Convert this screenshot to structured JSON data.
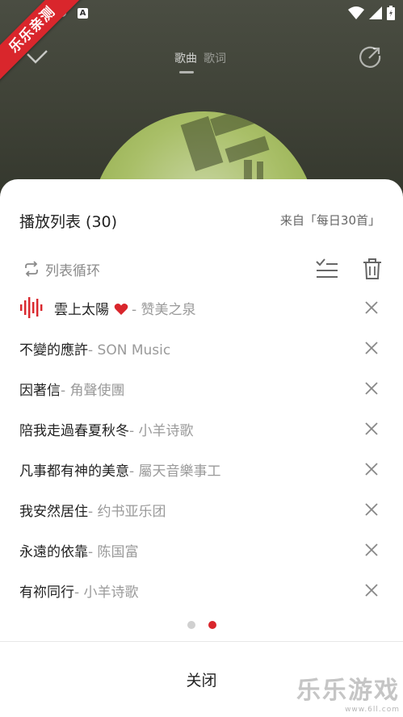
{
  "status_bar": {
    "icon_a": "A"
  },
  "ribbon": {
    "text": "乐乐亲测"
  },
  "player": {
    "tabs": [
      {
        "label": "歌曲",
        "active": true
      },
      {
        "label": "歌词",
        "active": false
      }
    ]
  },
  "playlist": {
    "title": "播放列表 (30)",
    "source": "来自「每日30首」",
    "mode_label": "列表循环",
    "songs": [
      {
        "title": "雲上太陽",
        "artist": "- 赞美之泉",
        "playing": true,
        "liked": true
      },
      {
        "title": "不變的應許",
        "artist": "- SON Music"
      },
      {
        "title": "因著信",
        "artist": "- 角聲使團"
      },
      {
        "title": "陪我走過春夏秋冬",
        "artist": "- 小羊诗歌"
      },
      {
        "title": "凡事都有神的美意",
        "artist": "- 屬天音樂事工"
      },
      {
        "title": "我安然居住",
        "artist": "- 约书亚乐团"
      },
      {
        "title": "永遠的依靠",
        "artist": "- 陈国富"
      },
      {
        "title": "有祢同行",
        "artist": "- 小羊诗歌"
      }
    ],
    "pager": {
      "total": 2,
      "active_index": 1
    },
    "close_label": "关闭"
  },
  "watermark": {
    "main": "乐乐游戏",
    "sub": "www.6ll.com"
  },
  "colors": {
    "accent": "#d9262c",
    "text_primary": "#222222",
    "text_secondary": "#9a9a9a"
  },
  "icons": [
    "collapse-check-icon",
    "share-icon",
    "repeat-icon",
    "multi-select-icon",
    "trash-icon",
    "equalizer-icon",
    "heart-icon",
    "close-icon"
  ]
}
